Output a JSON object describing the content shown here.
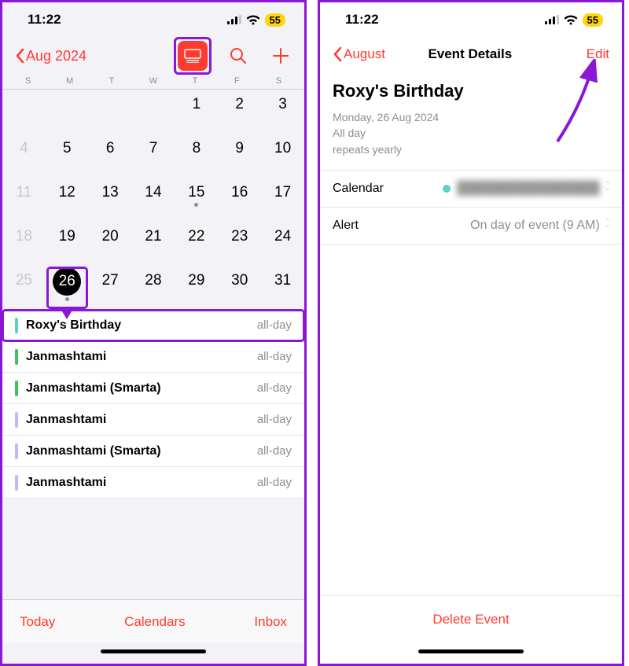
{
  "status": {
    "time": "11:22",
    "battery": "55"
  },
  "left": {
    "back_label": "Aug 2024",
    "weekdays": [
      "S",
      "M",
      "T",
      "W",
      "T",
      "F",
      "S"
    ],
    "grid": [
      [
        null,
        null,
        null,
        null,
        "1",
        "2",
        "3"
      ],
      [
        "4",
        "5",
        "6",
        "7",
        "8",
        "9",
        "10"
      ],
      [
        "11",
        "12",
        "13",
        "14",
        "15",
        "16",
        "17"
      ],
      [
        "18",
        "19",
        "20",
        "21",
        "22",
        "23",
        "24"
      ],
      [
        "25",
        "26",
        "27",
        "28",
        "29",
        "30",
        "31"
      ]
    ],
    "dim_cells": [
      "4",
      "11",
      "18",
      "25"
    ],
    "dot_cells": [
      "15",
      "26"
    ],
    "selected": "26",
    "events": [
      {
        "title": "Roxy's Birthday",
        "time": "all-day",
        "color": "#5ed0c8",
        "highlight": true
      },
      {
        "title": "Janmashtami",
        "time": "all-day",
        "color": "#34c759"
      },
      {
        "title": "Janmashtami (Smarta)",
        "time": "all-day",
        "color": "#34c759"
      },
      {
        "title": "Janmashtami",
        "time": "all-day",
        "color": "#c4b5fd"
      },
      {
        "title": "Janmashtami (Smarta)",
        "time": "all-day",
        "color": "#c4b5fd"
      },
      {
        "title": "Janmashtami",
        "time": "all-day",
        "color": "#c4b5fd"
      }
    ],
    "bottom": {
      "today": "Today",
      "calendars": "Calendars",
      "inbox": "Inbox"
    }
  },
  "right": {
    "back_label": "August",
    "header": "Event Details",
    "edit_label": "Edit",
    "title": "Roxy's Birthday",
    "date": "Monday, 26 Aug 2024",
    "allday": "All day",
    "repeat": "repeats yearly",
    "calendar_label": "Calendar",
    "calendar_value": "████████████████",
    "alert_label": "Alert",
    "alert_value": "On day of event (9 AM)",
    "delete": "Delete Event"
  }
}
